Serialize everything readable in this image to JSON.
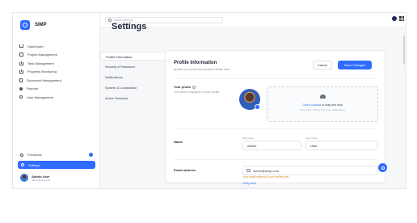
{
  "app": {
    "name": "SIMP"
  },
  "topbar": {
    "search_placeholder": "Search settings"
  },
  "sidebar": {
    "items": [
      {
        "label": "Dashboard",
        "icon": "home-icon"
      },
      {
        "label": "Project Management",
        "icon": "folder-icon"
      },
      {
        "label": "Task Management",
        "icon": "tasks-icon"
      },
      {
        "label": "Progress Monitoring",
        "icon": "chart-icon"
      },
      {
        "label": "Document Management",
        "icon": "document-icon"
      },
      {
        "label": "Reports",
        "icon": "report-icon"
      },
      {
        "label": "User Management",
        "icon": "users-icon"
      }
    ],
    "feedback": {
      "label": "Feedback",
      "badge": ""
    },
    "settings_label": "Settings",
    "user": {
      "name": "Admin User",
      "email": "admin@simp.com"
    }
  },
  "page": {
    "title": "Settings"
  },
  "subnav": {
    "items": [
      {
        "label": "Profile Information",
        "active": true
      },
      {
        "label": "Security & Password",
        "active": false
      },
      {
        "label": "Notifications",
        "active": false
      },
      {
        "label": "System & Localization",
        "active": false
      },
      {
        "label": "Active Sessions",
        "active": false
      }
    ]
  },
  "profile": {
    "title": "Profile Information",
    "subtitle": "Update your photo and personal details here.",
    "cancel_label": "Cancel",
    "save_label": "Save Changes",
    "photo": {
      "label": "Your photo",
      "description": "This will be displayed on your profile.",
      "upload_link": "Click to upload",
      "upload_text": " or drag and drop",
      "upload_hint": "SVG, PNG, JPG or GIF (max. 800x400px)"
    },
    "name": {
      "label": "Name",
      "first_label": "First name",
      "first_value": "Admin",
      "last_label": "Last name",
      "last_value": "User"
    },
    "email": {
      "label": "Email address",
      "value": "admin@simp.com",
      "warning": "Your email address is not verified yet.",
      "verify_label": "Verify Now"
    }
  },
  "colors": {
    "accent": "#2f6bff",
    "warning": "#d88a1a"
  }
}
